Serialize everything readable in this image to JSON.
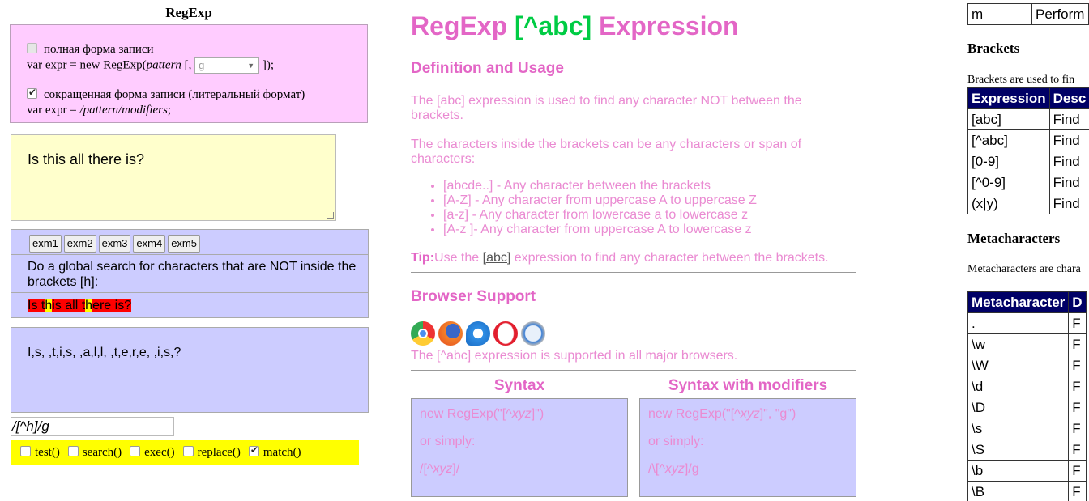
{
  "left": {
    "title": "RegExp",
    "full_form_label": "полная форма записи",
    "full_form_code_prefix": "var expr = new RegExp(",
    "full_form_code_pattern": "pattern",
    "full_form_code_mid": " [, ",
    "full_form_code_suffix": " ]);",
    "modifier_select_value": "g",
    "short_form_label": "сокращенная форма записи (литеральный формат)",
    "short_form_code_prefix": "var expr = ",
    "short_form_code_literal": "/pattern/modifiers",
    "short_form_code_suffix": ";",
    "textarea_value": "Is this all there is?",
    "example_buttons": [
      "exm1",
      "exm2",
      "exm3",
      "exm4",
      "exm5"
    ],
    "example_description": "Do a global search for characters that are NOT inside the brackets [h]:",
    "result_segments": [
      {
        "text": "Is t",
        "hl": "red"
      },
      {
        "text": "h",
        "hl": "yellow"
      },
      {
        "text": "is all t",
        "hl": "red"
      },
      {
        "text": "h",
        "hl": "yellow"
      },
      {
        "text": "ere is?",
        "hl": "red"
      }
    ],
    "match_output": "I,s, ,t,i,s, ,a,l,l, ,t,e,r,e, ,i,s,?",
    "pattern_input_value": "/[^h]/g",
    "methods": [
      {
        "label": "test()",
        "checked": false
      },
      {
        "label": "search()",
        "checked": false
      },
      {
        "label": "exec()",
        "checked": false
      },
      {
        "label": "replace()",
        "checked": false
      },
      {
        "label": "match()",
        "checked": true
      }
    ]
  },
  "middle": {
    "title_prefix": "RegExp ",
    "title_highlight": "[^abc]",
    "title_suffix": " Expression",
    "definition_heading": "Definition and Usage",
    "definition_p1": "The [abc] expression is used to find any character NOT between the brackets.",
    "definition_p2": "The characters inside the brackets can be any characters or span of characters:",
    "list_items": [
      "[abcde..] - Any character between the brackets",
      "[A-Z] - Any character from uppercase A to uppercase Z",
      "[a-z] - Any character from lowercase a to lowercase z",
      "[A-z ]- Any character from uppercase A to lowercase z"
    ],
    "tip_label": "Tip:",
    "tip_text_before": "Use the ",
    "tip_link": "[abc]",
    "tip_text_after": " expression to find any character between the brackets.",
    "browser_heading": "Browser Support",
    "browser_icons": [
      "chrome-icon",
      "firefox-icon",
      "internet-explorer-icon",
      "opera-icon",
      "safari-icon"
    ],
    "browser_text": "The [^abc] expression is supported in all major browsers.",
    "syntax_heading": "Syntax",
    "syntax_modifiers_heading": "Syntax with modifiers",
    "syntax_line1_prefix": "new RegExp(\"[^",
    "syntax_line1_italic": "xyz",
    "syntax_line1_suffix": "]\")",
    "syntax_or": "or simply:",
    "syntax_line2_prefix": "/[^",
    "syntax_line2_italic": "xyz",
    "syntax_line2_suffix": "]/",
    "mod_line1_prefix": "new RegExp(\"[^",
    "mod_line1_italic": "xyz",
    "mod_line1_suffix": "]\", \"g\")",
    "mod_or": "or simply:",
    "mod_line2_prefix": "/\\[^",
    "mod_line2_italic": "xyz",
    "mod_line2_suffix": "]/g",
    "colors": {
      "pink_heading": "#e366c6",
      "pink_text": "#ea8bd2",
      "green": "#00cc44",
      "code_box_bg": "#ccccff"
    }
  },
  "right": {
    "top_row": {
      "key": "m",
      "value": "Perform"
    },
    "brackets_heading": "Brackets",
    "brackets_text": "Brackets are used to fin",
    "brackets_header": [
      "Expression",
      "Desc"
    ],
    "brackets_rows": [
      [
        "[abc]",
        "Find"
      ],
      [
        "[^abc]",
        "Find"
      ],
      [
        "[0-9]",
        "Find"
      ],
      [
        "[^0-9]",
        "Find"
      ],
      [
        "(x|y)",
        "Find"
      ]
    ],
    "meta_heading": "Metacharacters",
    "meta_text": "Metacharacters are chara",
    "meta_header": [
      "Metacharacter",
      "D"
    ],
    "meta_rows": [
      [
        ".",
        "F"
      ],
      [
        "\\w",
        "F"
      ],
      [
        "\\W",
        "F"
      ],
      [
        "\\d",
        "F"
      ],
      [
        "\\D",
        "F"
      ],
      [
        "\\s",
        "F"
      ],
      [
        "\\S",
        "F"
      ],
      [
        "\\b",
        "F"
      ],
      [
        "\\B",
        "F"
      ]
    ],
    "colors": {
      "table_header_bg": "#000066"
    }
  }
}
